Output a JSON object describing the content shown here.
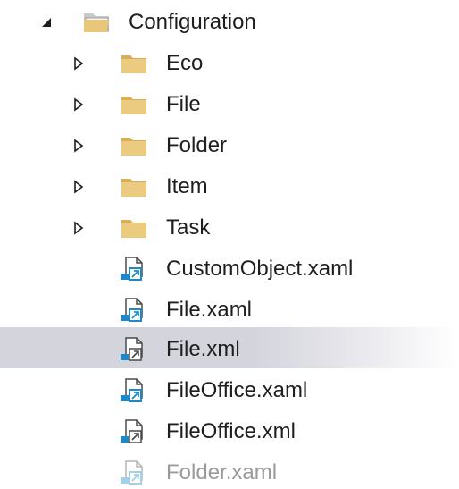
{
  "tree": {
    "root": {
      "label": "Configuration",
      "expanded": true,
      "icon": "folder-open-icon"
    },
    "folders": [
      {
        "label": "Eco",
        "icon": "folder-icon"
      },
      {
        "label": "File",
        "icon": "folder-icon"
      },
      {
        "label": "Folder",
        "icon": "folder-icon"
      },
      {
        "label": "Item",
        "icon": "folder-icon"
      },
      {
        "label": "Task",
        "icon": "folder-icon"
      }
    ],
    "files": [
      {
        "label": "CustomObject.xaml",
        "icon": "xaml-file-icon"
      },
      {
        "label": "File.xaml",
        "icon": "xaml-file-icon"
      },
      {
        "label": "File.xml",
        "icon": "xml-file-icon",
        "selected": true
      },
      {
        "label": "FileOffice.xaml",
        "icon": "xaml-file-icon"
      },
      {
        "label": "FileOffice.xml",
        "icon": "xml-file-icon"
      },
      {
        "label": "Folder.xaml",
        "icon": "xaml-file-icon"
      }
    ]
  },
  "colors": {
    "selection": "#d4d4dd",
    "folder": "#e8c77a",
    "folder_dark": "#d9ae55",
    "file_badge": "#1e88c9",
    "text": "#1e1e1e"
  }
}
